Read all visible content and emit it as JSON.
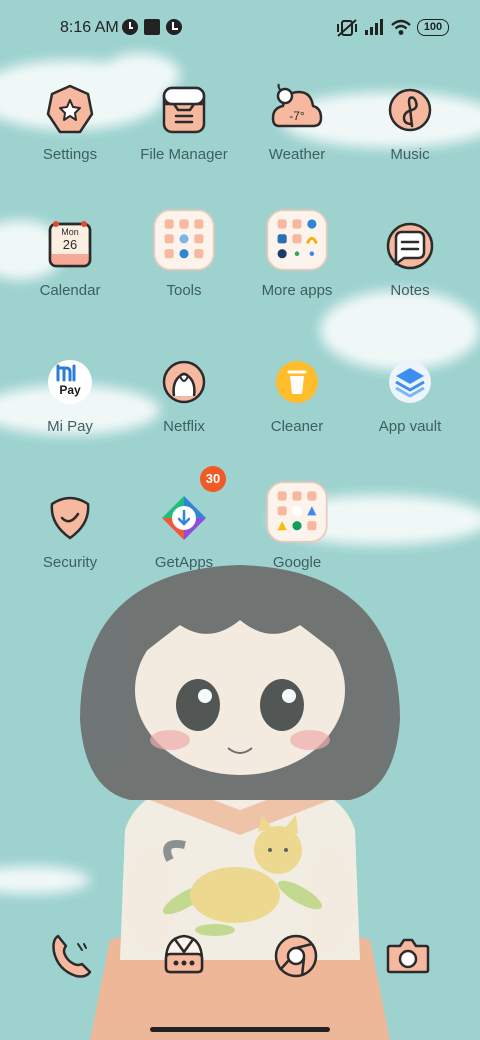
{
  "status_bar": {
    "time": "8:16 AM",
    "battery": "100",
    "icons": [
      "notification-icon-1",
      "notification-square-icon",
      "notification-icon-2",
      "vibrate-off-icon",
      "signal-icon",
      "wifi-icon",
      "battery-icon"
    ]
  },
  "apps": [
    {
      "label": "Settings",
      "icon": "settings-icon"
    },
    {
      "label": "File Manager",
      "icon": "file-manager-icon"
    },
    {
      "label": "Weather",
      "icon": "weather-icon",
      "temp": "-7°"
    },
    {
      "label": "Music",
      "icon": "music-icon"
    },
    {
      "label": "Calendar",
      "icon": "calendar-icon",
      "month": "Mon",
      "day": "26"
    },
    {
      "label": "Tools",
      "icon": "folder-icon"
    },
    {
      "label": "More apps",
      "icon": "folder-icon"
    },
    {
      "label": "Notes",
      "icon": "notes-icon"
    },
    {
      "label": "Mi Pay",
      "icon": "mi-pay-icon",
      "logo_text": "Pay"
    },
    {
      "label": "Netflix",
      "icon": "netflix-icon"
    },
    {
      "label": "Cleaner",
      "icon": "cleaner-icon"
    },
    {
      "label": "App vault",
      "icon": "app-vault-icon"
    },
    {
      "label": "Security",
      "icon": "security-icon"
    },
    {
      "label": "GetApps",
      "icon": "getapps-icon",
      "badge": "30"
    },
    {
      "label": "Google",
      "icon": "folder-icon"
    }
  ],
  "dock": [
    {
      "name": "phone",
      "icon": "phone-icon"
    },
    {
      "name": "messages",
      "icon": "messages-icon"
    },
    {
      "name": "browser",
      "icon": "browser-icon"
    },
    {
      "name": "camera",
      "icon": "camera-icon"
    }
  ],
  "colors": {
    "background": "#9dd2cf",
    "icon_fill": "#f6b99f",
    "icon_stroke": "#2b2b2b",
    "label": "#3f5f5f",
    "badge": "#f15a24"
  }
}
